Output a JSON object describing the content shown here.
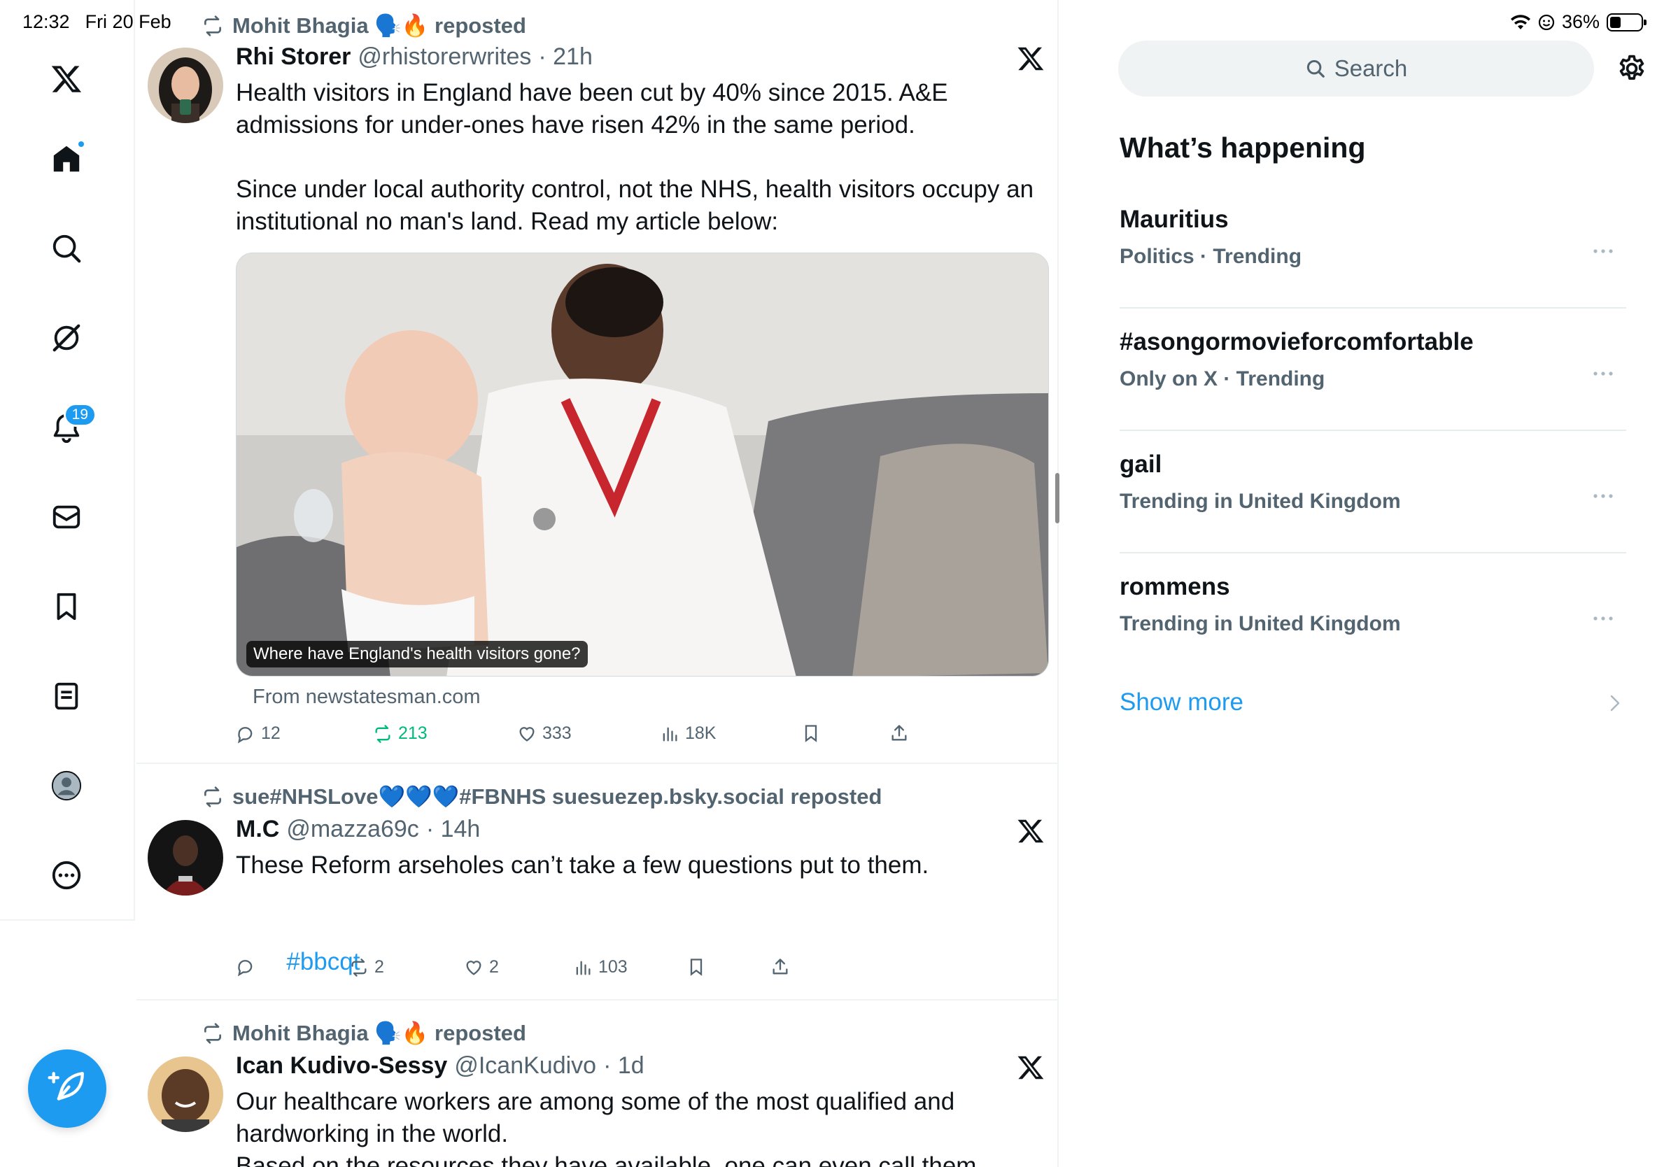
{
  "status_bar": {
    "time": "12:32",
    "date": "Fri 20 Feb",
    "battery": "36%"
  },
  "nav": {
    "notifications_count": "19",
    "items": [
      "x-logo",
      "home",
      "search",
      "grok",
      "notifications",
      "messages",
      "bookmarks",
      "lists",
      "profile",
      "more"
    ]
  },
  "tweets": [
    {
      "reposted_by": "Mohit Bhagia 🗣️🔥 reposted",
      "name": "Rhi Storer",
      "handle": "@rhistorerwrites",
      "time": "· 21h",
      "text": "Health visitors in England have been cut by 40% since 2015. A&E admissions for under-ones have risen 42% in the same period.\n\nSince under local authority control, not the NHS, health visitors occupy an institutional no man's land. Read my article below:",
      "card_caption": "Where have England's health visitors gone?",
      "card_source": "From newstatesman.com",
      "replies": "12",
      "reposts": "213",
      "likes": "333",
      "views": "18K"
    },
    {
      "reposted_by": "sue#NHSLove💙💙💙#FBNHS suesuezep.bsky.social reposted",
      "name": "M.C",
      "handle": "@mazza69c",
      "time": "· 14h",
      "text": "These Reform arseholes can’t take a few questions put to them.",
      "hashtag": "#bbcqt",
      "replies": "",
      "reposts": "2",
      "likes": "2",
      "views": "103"
    },
    {
      "reposted_by": "Mohit Bhagia 🗣️🔥 reposted",
      "name": "Ican Kudivo-Sessy",
      "handle": "@IcanKudivo",
      "time": "· 1d",
      "text": "Our healthcare workers are among some of the most qualified and hardworking in the world.\nBased on the resources they have available, one can even call them miracle"
    }
  ],
  "sidebar": {
    "search_placeholder": "Search",
    "title": "What’s happening",
    "trends": [
      {
        "name": "Mauritius",
        "meta": "Politics · Trending"
      },
      {
        "name": "#asongormovieforcomfortable",
        "meta": "Only on X · Trending"
      },
      {
        "name": "gail",
        "meta": "Trending in United Kingdom"
      },
      {
        "name": "rommens",
        "meta": "Trending in United Kingdom"
      }
    ],
    "show_more": "Show more"
  },
  "colors": {
    "accent": "#1d9bf0",
    "muted": "#536471",
    "repost_green": "#00ba7c"
  }
}
